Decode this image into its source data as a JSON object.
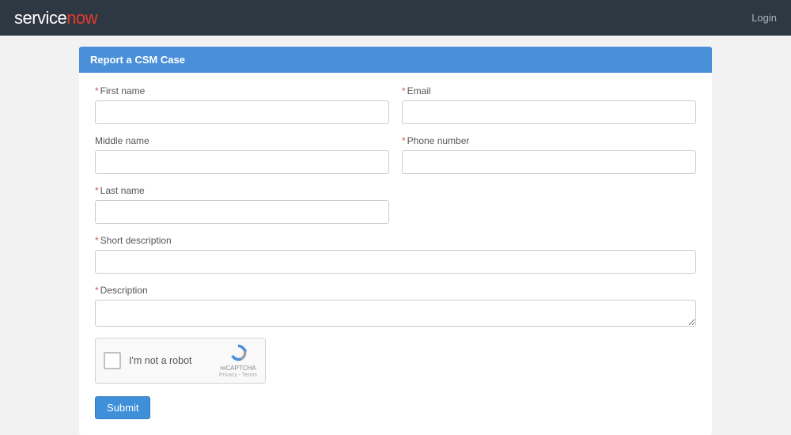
{
  "navbar": {
    "logo_service": "service",
    "logo_now": "now",
    "login": "Login"
  },
  "panel": {
    "title": "Report a CSM Case"
  },
  "form": {
    "first_name": {
      "label": "First name",
      "value": "",
      "required": true
    },
    "middle_name": {
      "label": "Middle name",
      "value": "",
      "required": false
    },
    "last_name": {
      "label": "Last name",
      "value": "",
      "required": true
    },
    "email": {
      "label": "Email",
      "value": "",
      "required": true
    },
    "phone": {
      "label": "Phone number",
      "value": "",
      "required": true
    },
    "short_description": {
      "label": "Short description",
      "value": "",
      "required": true
    },
    "description": {
      "label": "Description",
      "value": "",
      "required": true
    }
  },
  "recaptcha": {
    "label": "I'm not a robot",
    "brand": "reCAPTCHA",
    "terms": "Privacy - Terms"
  },
  "actions": {
    "submit": "Submit"
  }
}
